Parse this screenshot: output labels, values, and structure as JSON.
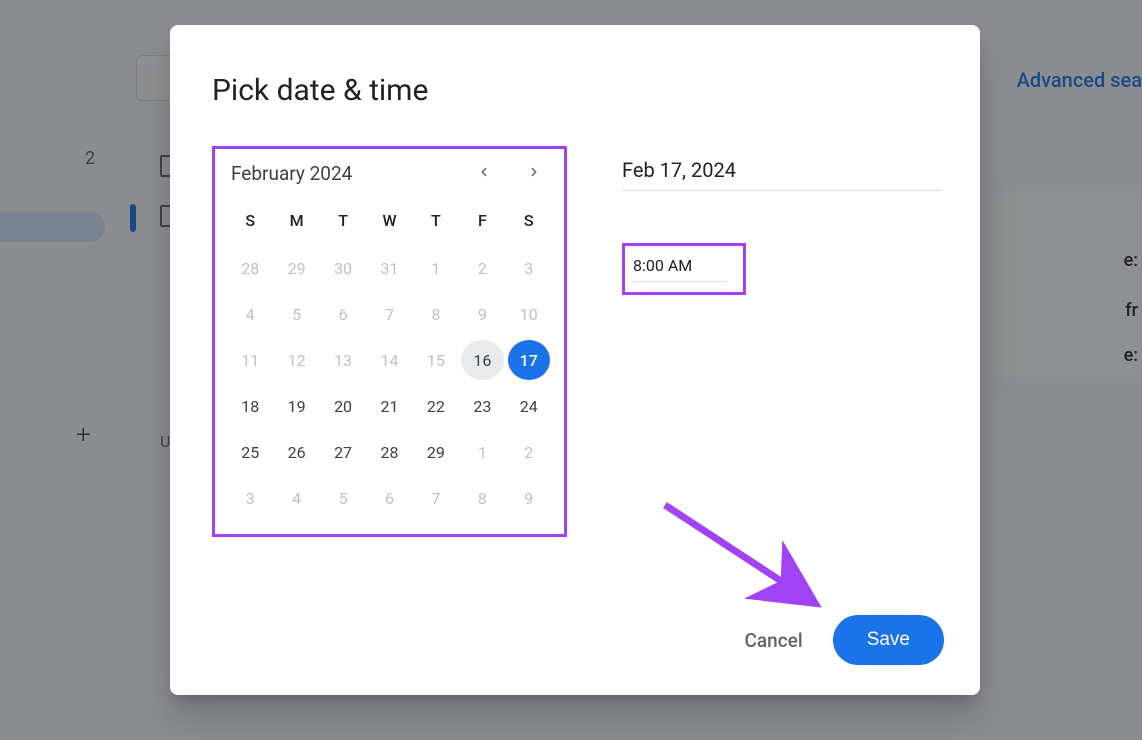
{
  "background": {
    "advanced_label": "Advanced sea",
    "sidebar_number": "2",
    "letter": "U"
  },
  "dialog": {
    "title": "Pick date & time",
    "calendar": {
      "month_label": "February 2024",
      "dow": [
        "S",
        "M",
        "T",
        "W",
        "T",
        "F",
        "S"
      ],
      "weeks": [
        [
          {
            "d": "28",
            "o": true
          },
          {
            "d": "29",
            "o": true
          },
          {
            "d": "30",
            "o": true
          },
          {
            "d": "31",
            "o": true
          },
          {
            "d": "1",
            "o": true
          },
          {
            "d": "2",
            "o": true
          },
          {
            "d": "3",
            "o": true
          }
        ],
        [
          {
            "d": "4",
            "o": true
          },
          {
            "d": "5",
            "o": true
          },
          {
            "d": "6",
            "o": true
          },
          {
            "d": "7",
            "o": true
          },
          {
            "d": "8",
            "o": true
          },
          {
            "d": "9",
            "o": true
          },
          {
            "d": "10",
            "o": true
          }
        ],
        [
          {
            "d": "11",
            "o": true
          },
          {
            "d": "12",
            "o": true
          },
          {
            "d": "13",
            "o": true
          },
          {
            "d": "14",
            "o": true
          },
          {
            "d": "15",
            "o": true
          },
          {
            "d": "16",
            "today": true
          },
          {
            "d": "17",
            "sel": true
          }
        ],
        [
          {
            "d": "18"
          },
          {
            "d": "19"
          },
          {
            "d": "20"
          },
          {
            "d": "21"
          },
          {
            "d": "22"
          },
          {
            "d": "23"
          },
          {
            "d": "24"
          }
        ],
        [
          {
            "d": "25"
          },
          {
            "d": "26"
          },
          {
            "d": "27"
          },
          {
            "d": "28"
          },
          {
            "d": "29"
          },
          {
            "d": "1",
            "o": true
          },
          {
            "d": "2",
            "o": true
          }
        ],
        [
          {
            "d": "3",
            "o": true
          },
          {
            "d": "4",
            "o": true
          },
          {
            "d": "5",
            "o": true
          },
          {
            "d": "6",
            "o": true
          },
          {
            "d": "7",
            "o": true
          },
          {
            "d": "8",
            "o": true
          },
          {
            "d": "9",
            "o": true
          }
        ]
      ]
    },
    "date_value": "Feb 17, 2024",
    "time_value": "8:00 AM",
    "cancel_label": "Cancel",
    "save_label": "Save"
  },
  "annotations": {
    "calendar_highlight_color": "#a142f4",
    "time_highlight_color": "#a142f4",
    "arrow_color": "#a142f4"
  }
}
